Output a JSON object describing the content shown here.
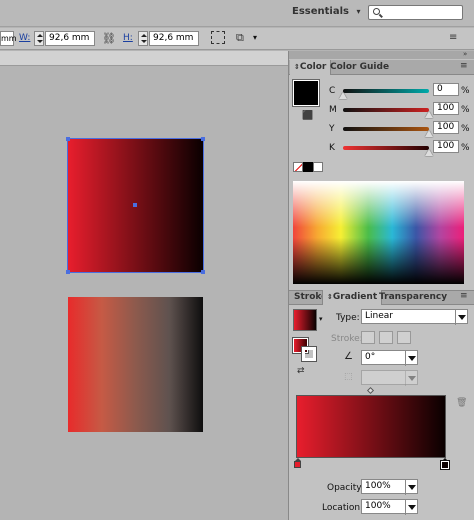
{
  "topbar": {
    "workspace": "Essentials",
    "search_placeholder": ""
  },
  "controlbar": {
    "unit_fragment": "mm",
    "w_label": "W:",
    "w_value": "92,6 mm",
    "h_label": "H:",
    "h_value": "92,6 mm"
  },
  "color_panel": {
    "tabs": [
      "Color",
      "Color Guide"
    ],
    "channels": [
      {
        "label": "C",
        "value": "0",
        "unit": "%",
        "level": 0
      },
      {
        "label": "M",
        "value": "100",
        "unit": "%",
        "level": 1
      },
      {
        "label": "Y",
        "value": "100",
        "unit": "%",
        "level": 1
      },
      {
        "label": "K",
        "value": "100",
        "unit": "%",
        "level": 1
      }
    ]
  },
  "gradient_panel": {
    "tabs": [
      "Stroke",
      "Gradient",
      "Transparency"
    ],
    "type_label": "Type:",
    "type_value": "Linear",
    "stroke_label": "Stroke:",
    "angle_value": "0°",
    "opacity_label": "Opacity:",
    "opacity_value": "100%",
    "location_label": "Location:",
    "location_value": "100%"
  },
  "colors": {
    "gradient_start": "#e81e2d",
    "gradient_end": "#0a0000",
    "selection": "#4a6ee0"
  }
}
